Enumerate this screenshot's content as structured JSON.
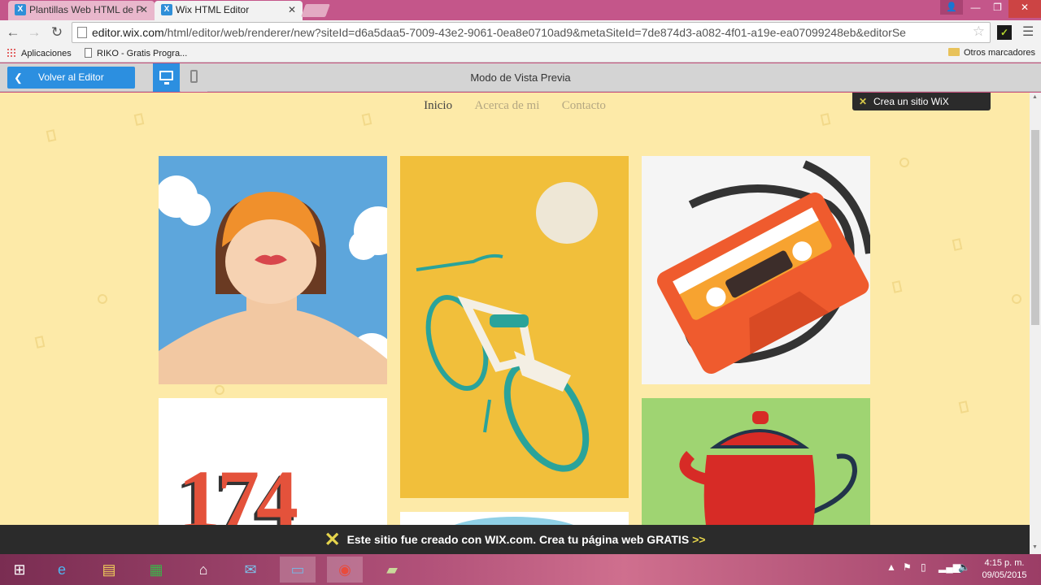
{
  "browser": {
    "tabs": [
      {
        "title": "Plantillas Web HTML de P",
        "active": false
      },
      {
        "title": "Wix HTML Editor",
        "active": true
      }
    ],
    "url_host": "editor.wix.com",
    "url_path": "/html/editor/web/renderer/new?siteId=d6a5daa5-7009-43e2-9061-0ea8e0710ad9&metaSiteId=7de874d3-a082-4f01-a19e-ea07099248eb&editorSe",
    "bookmarks": [
      "Aplicaciones",
      "RIKO - Gratis Progra..."
    ],
    "other_bookmarks": "Otros marcadores"
  },
  "preview_bar": {
    "back_label": "Volver al Editor",
    "title": "Modo de Vista Previa"
  },
  "site": {
    "nav": [
      "Inicio",
      "Acerca de mi",
      "Contacto"
    ],
    "badge": "Crea un sitio WiX",
    "footer_main": "Este sitio fue creado con WIX.com. Crea tu página web GRATIS",
    "footer_arrow": ">>",
    "tile_number": "174"
  },
  "taskbar": {
    "time": "4:15 p. m.",
    "date": "09/05/2015"
  },
  "colors": {
    "site_bg": "#fdeaa8",
    "accent": "#2c8fe0",
    "wix_yellow": "#e5d44c"
  }
}
